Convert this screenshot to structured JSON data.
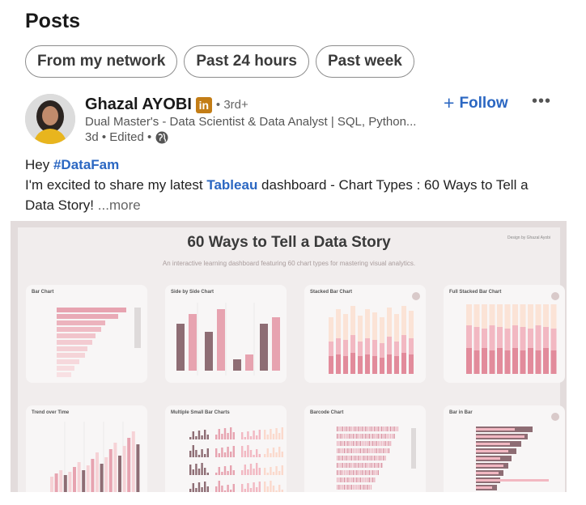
{
  "page_title": "Posts",
  "filters": [
    "From my network",
    "Past 24 hours",
    "Past week"
  ],
  "post": {
    "author": "Ghazal AYOBI",
    "badge": "in",
    "degree": "• 3rd+",
    "headline": "Dual Master's - Data Scientist & Data Analyst | SQL, Python...",
    "meta": "3d • Edited •",
    "follow_label": "Follow",
    "more_menu": "•••",
    "text": {
      "line1_prefix": "Hey ",
      "hashtag": "#DataFam",
      "line2_prefix": "I'm excited to share my latest ",
      "tag": "Tableau",
      "line2_suffix": " dashboard - Chart Types : 60 Ways to Tell a Data Story!",
      "see_more": "...more"
    }
  },
  "dashboard": {
    "title": "60 Ways to Tell a Data Story",
    "subtitle": "An interactive learning dashboard featuring 60 chart types for mastering visual analytics.",
    "credit": "Design by Ghazal Ayobi",
    "cards": [
      {
        "title": "Bar Chart"
      },
      {
        "title": "Side by Side Chart"
      },
      {
        "title": "Stacked Bar Chart"
      },
      {
        "title": "Full Stacked Bar Chart"
      },
      {
        "title": "Trend over Time"
      },
      {
        "title": "Multiple Small Bar Charts"
      },
      {
        "title": "Barcode Chart"
      },
      {
        "title": "Bar in Bar"
      }
    ]
  },
  "colors": {
    "link": "#2b67c2",
    "badge": "#c37d16",
    "pink": "#e7a3b0",
    "light_pink": "#f6d2d6",
    "mauve": "#8e6d74"
  }
}
